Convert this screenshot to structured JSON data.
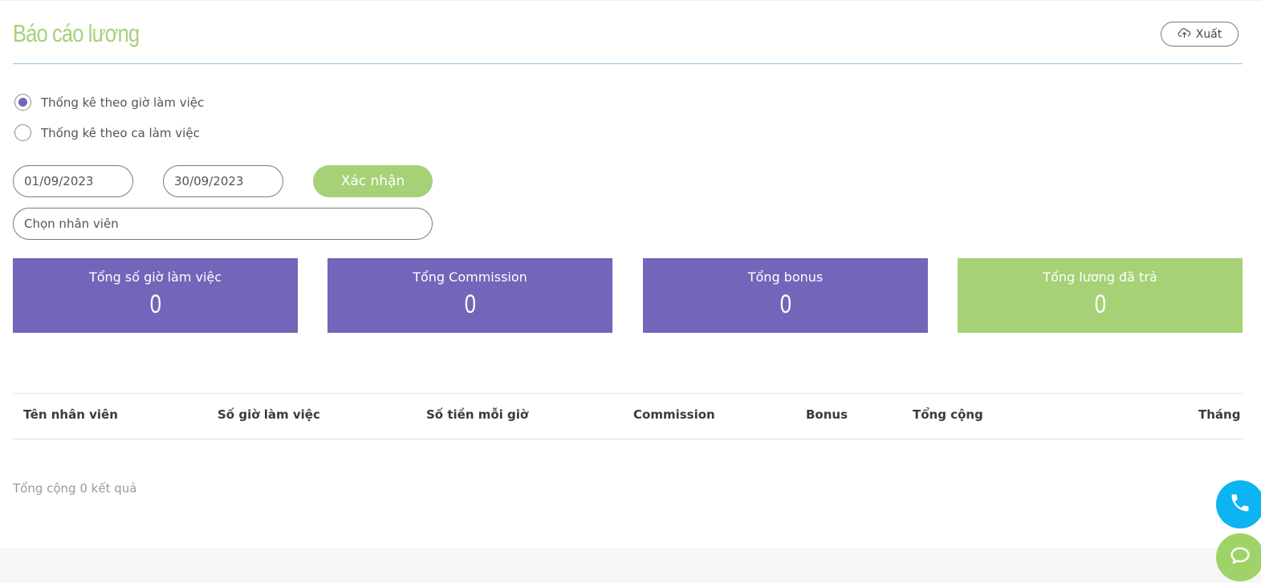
{
  "header": {
    "title": "Báo cáo lương",
    "export_label": "Xuất"
  },
  "filters": {
    "radios": [
      {
        "label": "Thống kê theo giờ làm việc",
        "selected": true
      },
      {
        "label": "Thống kê theo ca làm việc",
        "selected": false
      }
    ],
    "date_from": "01/09/2023",
    "date_to": "30/09/2023",
    "confirm_label": "Xác nhận",
    "employee_placeholder": "Chọn nhân viên"
  },
  "stats": [
    {
      "label": "Tổng số giờ làm việc",
      "value": "0",
      "color": "#7266ba"
    },
    {
      "label": "Tổng Commission",
      "value": "0",
      "color": "#7266ba"
    },
    {
      "label": "Tổng bonus",
      "value": "0",
      "color": "#7266ba"
    },
    {
      "label": "Tổng lương đã trả",
      "value": "0",
      "color": "#a6d177"
    }
  ],
  "table": {
    "columns": [
      "Tên nhân viên",
      "Số giờ làm việc",
      "Số tiền mỗi giờ",
      "Commission",
      "Bonus",
      "Tổng cộng",
      "Tháng"
    ],
    "rows": []
  },
  "result_summary": "Tổng cộng 0 kết quả",
  "floating_buttons": {
    "phone_icon": "phone-icon",
    "chat_icon": "chat-bubble-icon"
  },
  "colors": {
    "accent_green": "#a6d177",
    "accent_purple": "#7266ba",
    "phone_blue": "#0db4f2"
  }
}
